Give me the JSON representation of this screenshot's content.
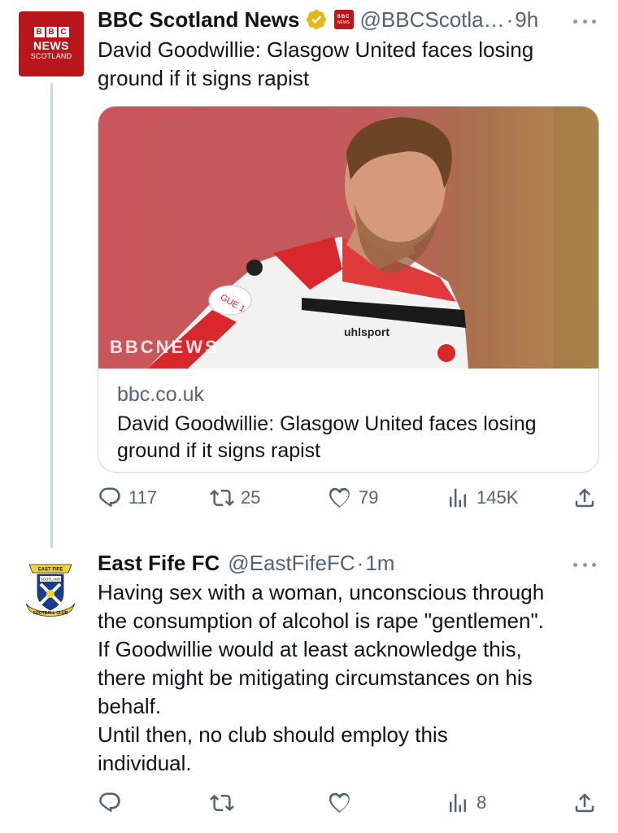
{
  "tweets": [
    {
      "name": "BBC Scotland News",
      "handle": "@BBCScotla…",
      "separator": "·",
      "time": "9h",
      "avatar_text": {
        "blocks": [
          "B",
          "B",
          "C"
        ],
        "line1": "NEWS",
        "line2": "SCOTLAND"
      },
      "affiliate_badge": {
        "line1": "BBC",
        "line2": "NEWS"
      },
      "text": "David Goodwillie: Glasgow United faces losing ground if it signs rapist",
      "card": {
        "image_watermark": "BBCNEWS",
        "shirt_sponsor": "uhlsport",
        "sleeve_patch": "GUE 1",
        "domain": "bbc.co.uk",
        "title": "David Goodwillie: Glasgow United faces losing ground if it signs rapist"
      },
      "stats": {
        "replies": "117",
        "retweets": "25",
        "likes": "79",
        "views": "145K"
      }
    },
    {
      "name": "East Fife FC",
      "handle": "@EastFifeFC",
      "separator": "·",
      "time": "1m",
      "avatar_text": {
        "top": "EAST FIFE",
        "inner": "SCOTLAND",
        "bottom": "FOOTBALL CLUB"
      },
      "text": "Having sex with a woman, unconscious through\nthe consumption of alcohol is rape \"gentlemen\".\nIf Goodwillie would at least acknowledge this,\nthere might be mitigating circumstances on his\nbehalf.\nUntil then, no club should employ this\nindividual.",
      "stats": {
        "replies": "",
        "retweets": "",
        "likes": "",
        "views": "8"
      }
    }
  ],
  "colors": {
    "text": "#0f1419",
    "secondary": "#536471",
    "bbc_red": "#b8161b",
    "verified_gold": "#e2b719",
    "border": "#cfd9de"
  },
  "icons": [
    "reply-icon",
    "retweet-icon",
    "like-icon",
    "views-icon",
    "share-icon",
    "more-icon",
    "verified-badge-icon"
  ]
}
